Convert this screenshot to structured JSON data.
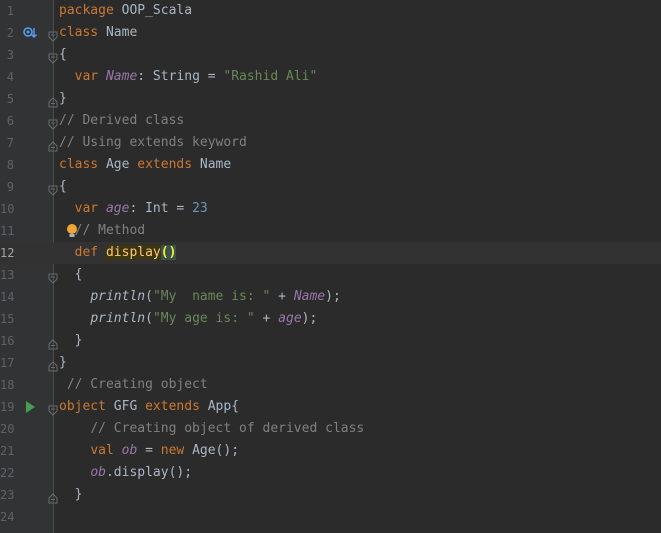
{
  "editor": {
    "language": "Scala",
    "current_line": 12,
    "colors": {
      "background": "#2b2b2b",
      "gutter": "#313335",
      "keyword": "#cc7832",
      "string": "#6a8759",
      "number": "#6897bb",
      "comment": "#808080",
      "field": "#9876aa",
      "default": "#a9b7c6"
    }
  },
  "lines": [
    {
      "n": "1",
      "tokens": [
        [
          "kw",
          "package"
        ],
        [
          "",
          " OOP_Scala"
        ]
      ]
    },
    {
      "n": "2",
      "tokens": [
        [
          "kw",
          "class"
        ],
        [
          "",
          " Name"
        ]
      ]
    },
    {
      "n": "3",
      "tokens": [
        [
          "",
          "{"
        ]
      ]
    },
    {
      "n": "4",
      "tokens": [
        [
          "",
          "  "
        ],
        [
          "kw",
          "var"
        ],
        [
          "",
          " "
        ],
        [
          "fld",
          "Name"
        ],
        [
          "",
          ": String = "
        ],
        [
          "str",
          "\"Rashid Ali\""
        ]
      ]
    },
    {
      "n": "5",
      "tokens": [
        [
          "",
          "}"
        ]
      ]
    },
    {
      "n": "6",
      "tokens": [
        [
          "cmt",
          "// Derived class"
        ]
      ]
    },
    {
      "n": "7",
      "tokens": [
        [
          "cmt",
          "// Using extends keyword"
        ]
      ]
    },
    {
      "n": "8",
      "tokens": [
        [
          "kw",
          "class"
        ],
        [
          "",
          " Age "
        ],
        [
          "kw",
          "extends"
        ],
        [
          "",
          " Name"
        ]
      ]
    },
    {
      "n": "9",
      "tokens": [
        [
          "",
          "{"
        ]
      ]
    },
    {
      "n": "10",
      "tokens": [
        [
          "",
          "  "
        ],
        [
          "kw",
          "var"
        ],
        [
          "",
          " "
        ],
        [
          "fld",
          "age"
        ],
        [
          "",
          ": Int = "
        ],
        [
          "num",
          "23"
        ]
      ]
    },
    {
      "n": "11",
      "tokens": [
        [
          "",
          "  "
        ],
        [
          "cmt",
          "// Method"
        ]
      ]
    },
    {
      "n": "12",
      "tokens": [
        [
          "",
          "  "
        ],
        [
          "kw",
          "def"
        ],
        [
          "",
          " "
        ],
        [
          "hl-method",
          "display"
        ],
        [
          "hl-paren",
          "()"
        ]
      ]
    },
    {
      "n": "13",
      "tokens": [
        [
          "",
          "  {"
        ]
      ]
    },
    {
      "n": "14",
      "tokens": [
        [
          "",
          "    "
        ],
        [
          "it",
          "println"
        ],
        [
          "",
          "("
        ],
        [
          "str",
          "\"My  name is: \""
        ],
        [
          "",
          " + "
        ],
        [
          "fld",
          "Name"
        ],
        [
          "",
          ");"
        ]
      ]
    },
    {
      "n": "15",
      "tokens": [
        [
          "",
          "    "
        ],
        [
          "it",
          "println"
        ],
        [
          "",
          "("
        ],
        [
          "str",
          "\"My age is: \""
        ],
        [
          "",
          " + "
        ],
        [
          "fld",
          "age"
        ],
        [
          "",
          ");"
        ]
      ]
    },
    {
      "n": "16",
      "tokens": [
        [
          "",
          "  }"
        ]
      ]
    },
    {
      "n": "17",
      "tokens": [
        [
          "",
          "}"
        ]
      ]
    },
    {
      "n": "18",
      "tokens": [
        [
          "cmt",
          " // Creating object"
        ]
      ]
    },
    {
      "n": "19",
      "tokens": [
        [
          "kw",
          "object"
        ],
        [
          "",
          " GFG "
        ],
        [
          "kw",
          "extends"
        ],
        [
          "",
          " App{"
        ]
      ]
    },
    {
      "n": "20",
      "tokens": [
        [
          "",
          "    "
        ],
        [
          "cmt",
          "// Creating object of derived class"
        ]
      ]
    },
    {
      "n": "21",
      "tokens": [
        [
          "",
          "    "
        ],
        [
          "kw",
          "val"
        ],
        [
          "",
          " "
        ],
        [
          "fld",
          "ob"
        ],
        [
          "",
          " = "
        ],
        [
          "kw",
          "new"
        ],
        [
          "",
          " Age();"
        ]
      ]
    },
    {
      "n": "22",
      "tokens": [
        [
          "",
          "    "
        ],
        [
          "fld",
          "ob"
        ],
        [
          "",
          ".display();"
        ]
      ]
    },
    {
      "n": "23",
      "tokens": [
        [
          "",
          "  }"
        ]
      ]
    },
    {
      "n": "24",
      "tokens": []
    }
  ],
  "markers": {
    "2": "override-indicator-icon",
    "11": "lightbulb-icon",
    "19": "run-icon"
  },
  "folds": {
    "2": "open",
    "3": "open",
    "5": "close",
    "6": "open",
    "7": "close",
    "9": "open",
    "13": "open",
    "16": "close",
    "17": "close",
    "19": "open",
    "23": "close"
  }
}
